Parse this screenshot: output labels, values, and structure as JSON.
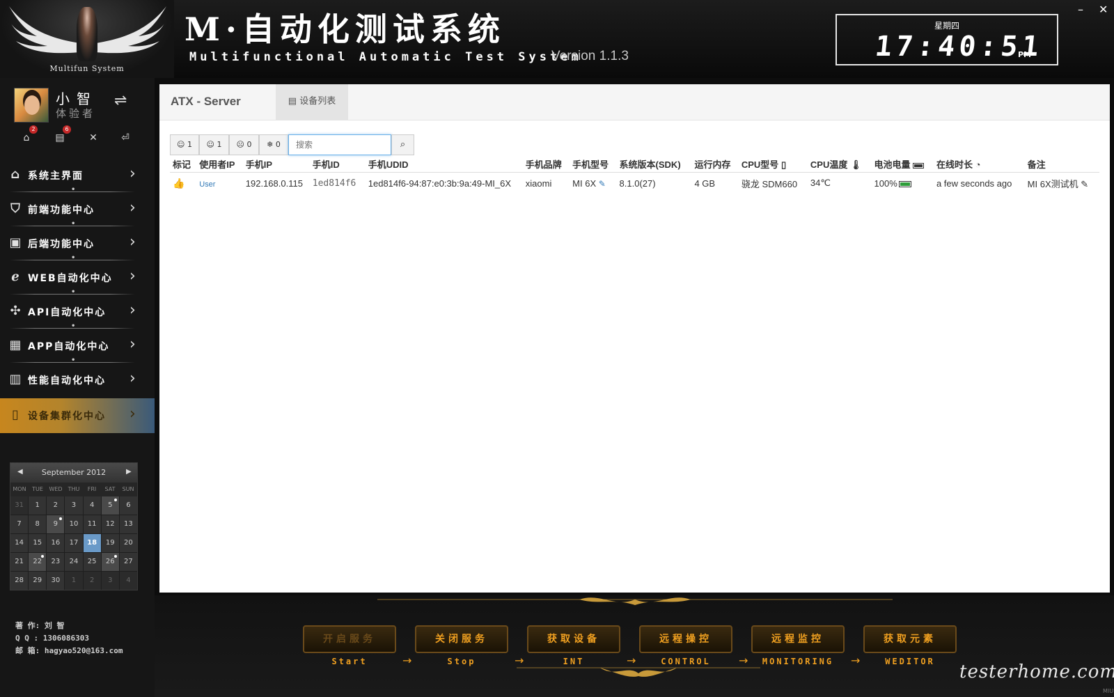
{
  "header": {
    "logo_sub": "Multifun System",
    "title_cn": "M·自动化测试系统",
    "title_en": "Multifunctional Automatic Test System",
    "version": "Version 1.1.3",
    "clock": {
      "day": "星期四",
      "time": "17:40:51",
      "ampm": "PM"
    },
    "minimize": "–",
    "close": "✕"
  },
  "user": {
    "name": "小智",
    "role": "体验者",
    "badges": {
      "inbox": "2",
      "docs": "6"
    }
  },
  "menu": [
    {
      "label": "系统主界面",
      "icon": "home-icon"
    },
    {
      "label": "前端功能中心",
      "icon": "html5-icon"
    },
    {
      "label": "后端功能中心",
      "icon": "monitor-chart-icon"
    },
    {
      "label": "WEB自动化中心",
      "icon": "ie-icon"
    },
    {
      "label": "API自动化中心",
      "icon": "api-icon"
    },
    {
      "label": "APP自动化中心",
      "icon": "app-icon"
    },
    {
      "label": "性能自动化中心",
      "icon": "bar-chart-icon"
    },
    {
      "label": "设备集群化中心",
      "icon": "tablet-icon",
      "active": true
    }
  ],
  "calendar": {
    "title": "September 2012",
    "dow": [
      "MON",
      "TUE",
      "WED",
      "THU",
      "FRI",
      "SAT",
      "SUN"
    ],
    "cells": [
      "31",
      "1",
      "2",
      "3",
      "4",
      "5",
      "6",
      "7",
      "8",
      "9",
      "10",
      "11",
      "12",
      "13",
      "14",
      "15",
      "16",
      "17",
      "18",
      "19",
      "20",
      "21",
      "22",
      "23",
      "24",
      "25",
      "26",
      "27",
      "28",
      "29",
      "30",
      "1",
      "2",
      "3",
      "4"
    ],
    "other": [
      0,
      31,
      32,
      33,
      34
    ],
    "marked": [
      5,
      9,
      22,
      26
    ],
    "today": 18
  },
  "author": {
    "line1": "著 作: 刘 智",
    "line2": "Q Q : 1306086303",
    "line3": "邮 箱: hagyao520@163.com"
  },
  "main": {
    "server_title": "ATX - Server",
    "tab_label": "设备列表",
    "filters": [
      {
        "icon": "smile-icon",
        "count": "1"
      },
      {
        "icon": "meh-icon",
        "count": "1"
      },
      {
        "icon": "frown-icon",
        "count": "0"
      },
      {
        "icon": "snowflake-icon",
        "count": "0"
      }
    ],
    "search_placeholder": "搜索",
    "columns": [
      "标记",
      "使用者IP",
      "手机IP",
      "手机ID",
      "手机UDID",
      "手机品牌",
      "手机型号",
      "系统版本(SDK)",
      "运行内存",
      "CPU型号",
      "CPU温度",
      "电池电量",
      "在线时长",
      "备注"
    ],
    "rows": [
      {
        "mark": "👍",
        "user_ip": "User",
        "phone_ip": "192.168.0.115",
        "phone_id": "1ed814f6",
        "udid": "1ed814f6-94:87:e0:3b:9a:49-MI_6X",
        "brand": "xiaomi",
        "model": "MI 6X",
        "sdk": "8.1.0(27)",
        "memory": "4 GB",
        "cpu": "骁龙 SDM660",
        "temp": "34℃",
        "battery": "100%",
        "battery_level": 1.0,
        "online": "a few seconds ago",
        "note": "MI 6X测试机"
      }
    ]
  },
  "controls": [
    {
      "label": "开启服务",
      "sub": "Start",
      "disabled": true
    },
    {
      "label": "关闭服务",
      "sub": "Stop",
      "disabled": false
    },
    {
      "label": "获取设备",
      "sub": "INT",
      "disabled": false
    },
    {
      "label": "远程操控",
      "sub": "CONTROL",
      "disabled": false
    },
    {
      "label": "远程监控",
      "sub": "MONITORING",
      "disabled": false
    },
    {
      "label": "获取元素",
      "sub": "WEDITOR",
      "disabled": false
    }
  ],
  "watermark": "testerhome.com",
  "mini_logo": "MIUI",
  "colors": {
    "accent": "#f0a020",
    "active_menu": "#c7861e",
    "link": "#337ab7",
    "ok": "#2e9d3a"
  }
}
